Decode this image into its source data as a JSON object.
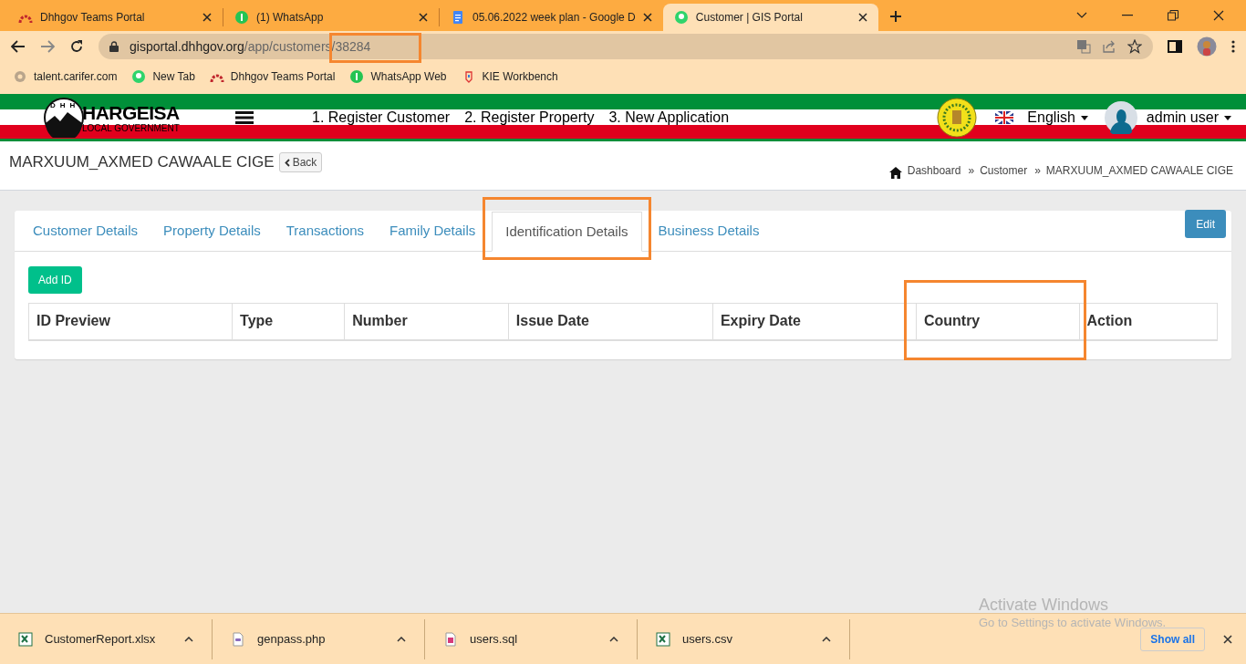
{
  "browser_tabs": [
    {
      "title": "Dhhgov Teams Portal",
      "selected": false
    },
    {
      "title": "(1) WhatsApp",
      "selected": false
    },
    {
      "title": "05.06.2022 week plan - Google D",
      "selected": false
    },
    {
      "title": "Customer | GIS Portal",
      "selected": true
    }
  ],
  "address": {
    "host": "gisportal.dhhgov.org",
    "path": "/app/customers/38284"
  },
  "bookmarks": [
    {
      "label": "talent.carifer.com"
    },
    {
      "label": "New Tab"
    },
    {
      "label": "Dhhgov Teams Portal"
    },
    {
      "label": "WhatsApp Web"
    },
    {
      "label": "KIE Workbench"
    }
  ],
  "site_header": {
    "logo_title": "HARGEISA",
    "logo_subtitle": "LOCAL GOVERNMENT",
    "logo_letters": [
      "D",
      "H",
      "H"
    ],
    "nav": [
      "1. Register Customer",
      "2. Register Property",
      "3. New Application"
    ],
    "language": "English",
    "user": "admin user"
  },
  "page": {
    "title": "MARXUUM_AXMED CAWAALE CIGE",
    "back": "Back",
    "breadcrumb": [
      "Dashboard",
      "Customer",
      "MARXUUM_AXMED CAWAALE CIGE"
    ],
    "separator": "»"
  },
  "tabs": [
    {
      "label": "Customer Details",
      "selected": false
    },
    {
      "label": "Property Details",
      "selected": false
    },
    {
      "label": "Transactions",
      "selected": false
    },
    {
      "label": "Family Details",
      "selected": false
    },
    {
      "label": "Identification Details",
      "selected": true
    },
    {
      "label": "Business Details",
      "selected": false
    }
  ],
  "edit_button": "Edit",
  "add_button": "Add ID",
  "table": {
    "columns": [
      "ID Preview",
      "Type",
      "Number",
      "Issue Date",
      "Expiry Date",
      "Country",
      "Action"
    ]
  },
  "downloads": [
    {
      "name": "CustomerReport.xlsx",
      "kind": "sheet"
    },
    {
      "name": "genpass.php",
      "kind": "script"
    },
    {
      "name": "users.sql",
      "kind": "db"
    },
    {
      "name": "users.csv",
      "kind": "sheet"
    }
  ],
  "show_all": "Show all",
  "os_notice": {
    "title": "Activate Windows",
    "text": "Go to Settings to activate Windows."
  }
}
